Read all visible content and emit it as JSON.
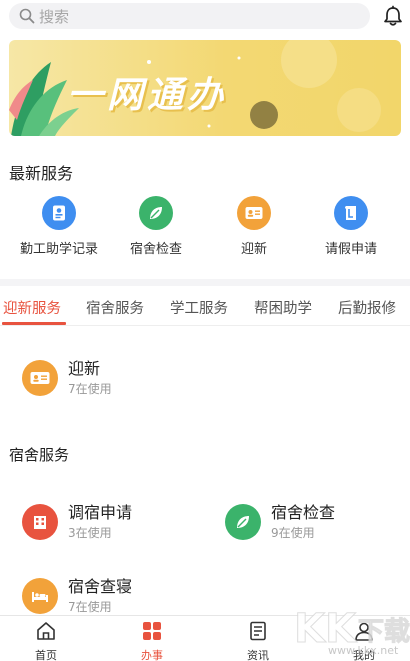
{
  "search": {
    "placeholder": "搜索",
    "icon": "search-icon"
  },
  "banner": {
    "title": "一网通办"
  },
  "latest_services": {
    "title": "最新服务",
    "items": [
      {
        "label": "勤工助学记录",
        "icon": "id-card-icon",
        "color": "#3f8ef0"
      },
      {
        "label": "宿舍检查",
        "icon": "leaf-icon",
        "color": "#3bb36b"
      },
      {
        "label": "迎新",
        "icon": "badge-card-icon",
        "color": "#f2a23a"
      },
      {
        "label": "请假申请",
        "icon": "leave-doc-icon",
        "color": "#3f8ef0"
      }
    ]
  },
  "tabs": [
    {
      "label": "迎新服务",
      "active": true
    },
    {
      "label": "宿舍服务",
      "active": false
    },
    {
      "label": "学工服务",
      "active": false
    },
    {
      "label": "帮困助学",
      "active": false
    },
    {
      "label": "后勤报修",
      "active": false
    }
  ],
  "welcome_section": {
    "cards": [
      {
        "name": "迎新",
        "usage": "7在使用",
        "icon": "badge-card-icon",
        "color": "#f2a23a"
      }
    ]
  },
  "dorm_section": {
    "title": "宿舍服务",
    "cards": [
      {
        "name": "调宿申请",
        "usage": "3在使用",
        "icon": "building-icon",
        "color": "#e8533f"
      },
      {
        "name": "宿舍检查",
        "usage": "9在使用",
        "icon": "leaf-icon",
        "color": "#3bb36b"
      },
      {
        "name": "宿舍查寝",
        "usage": "7在使用",
        "icon": "bed-icon",
        "color": "#f2a23a"
      }
    ]
  },
  "bottom_nav": [
    {
      "label": "首页",
      "icon": "home-icon",
      "active": false
    },
    {
      "label": "办事",
      "icon": "grid-icon",
      "active": true
    },
    {
      "label": "资讯",
      "icon": "news-icon",
      "active": false
    },
    {
      "label": "我的",
      "icon": "user-icon",
      "active": false
    }
  ],
  "watermark": {
    "text": "KK下载",
    "url_text": "www.kkx.net"
  },
  "colors": {
    "accent": "#e8533f",
    "banner_yellow": "#f3d873"
  }
}
